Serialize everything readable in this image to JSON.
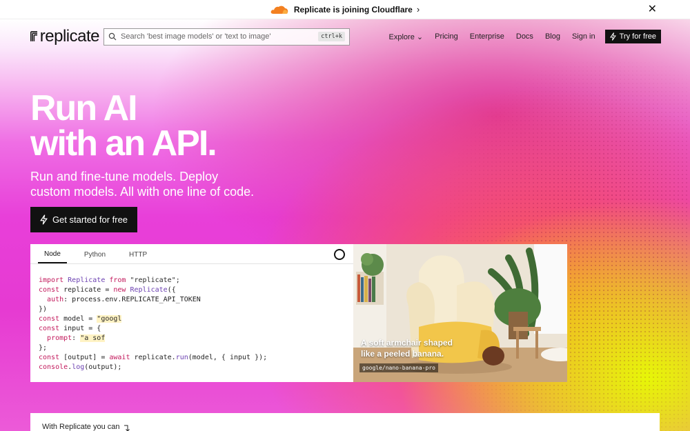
{
  "announcement": {
    "text": "Replicate is joining Cloudflare",
    "icon": "cloudflare-cloud-icon",
    "close_glyph": "✕"
  },
  "nav": {
    "logo_text": "replicate",
    "search_placeholder": "Search 'best image models' or 'text to image'",
    "search_shortcut": "ctrl+k",
    "links": [
      "Explore",
      "Pricing",
      "Enterprise",
      "Docs",
      "Blog",
      "Sign in"
    ],
    "cta_label": "Try for free"
  },
  "hero": {
    "title_line1": "Run AI",
    "title_line2": "with an API.",
    "subtitle_line1": "Run and fine-tune models. Deploy",
    "subtitle_line2": "custom models. All with one line of code.",
    "cta_label": "Get started for free"
  },
  "code_panel": {
    "tabs": [
      "Node",
      "Python",
      "HTTP"
    ],
    "active_tab": "Node"
  },
  "example": {
    "caption_line1": "A soft armchair shaped",
    "caption_line2": "like a peeled banana.",
    "model": "google/nano-banana-pro"
  },
  "section": {
    "label": "With Replicate you can"
  },
  "colors": {
    "accent_dark": "#111111",
    "hero_pink": "#e63ad2",
    "hero_yellow": "#e6ff00",
    "cloudflare_orange": "#f38020"
  }
}
